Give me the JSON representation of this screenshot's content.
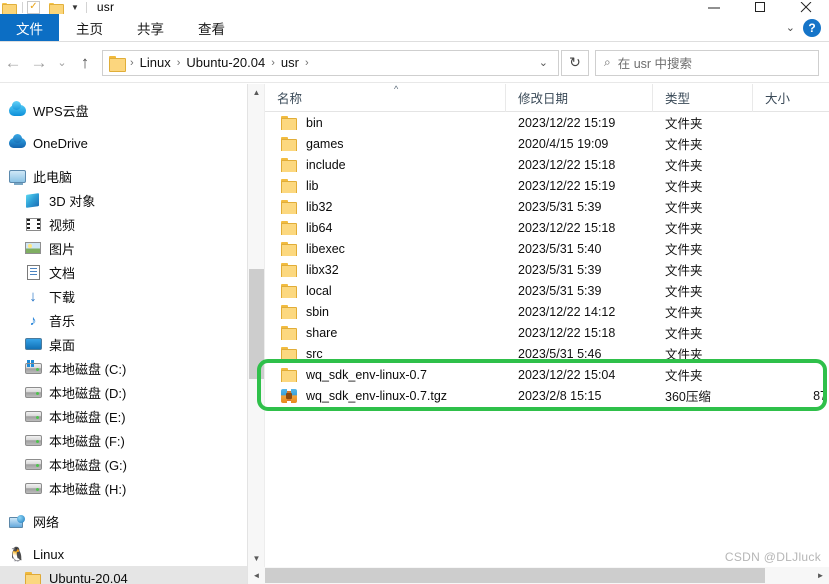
{
  "window": {
    "title": "usr",
    "quick_access": {
      "checkbox_icon": "checkbox-checked-icon",
      "folder_icon": "folder-icon",
      "dropdown_icon": "chevron-down-icon"
    },
    "controls": {
      "minimize": "minimize-icon",
      "maximize": "maximize-icon",
      "close": "close-icon"
    }
  },
  "ribbon": {
    "tabs": [
      {
        "label": "文件",
        "active": true
      },
      {
        "label": "主页",
        "active": false
      },
      {
        "label": "共享",
        "active": false
      },
      {
        "label": "查看",
        "active": false
      }
    ],
    "collapse_icon": "chevron-down-icon",
    "help_label": "?"
  },
  "navigation": {
    "back_label": "←",
    "forward_label": "→",
    "recent_label": "⌄",
    "up_label": "↑",
    "breadcrumb": [
      "Linux",
      "Ubuntu-20.04",
      "usr"
    ],
    "breadcrumb_separator": "›",
    "address_dropdown": "⌄",
    "refresh_label": "↻",
    "search": {
      "placeholder": "在 usr 中搜索",
      "icon": "search-icon"
    }
  },
  "sidebar": {
    "items": [
      {
        "label": "WPS云盘",
        "icon": "wps-cloud-icon",
        "level": 0,
        "selected": false,
        "gap_before": false
      },
      {
        "label": "OneDrive",
        "icon": "onedrive-cloud-icon",
        "level": 0,
        "selected": false,
        "gap_before": true
      },
      {
        "label": "此电脑",
        "icon": "this-pc-icon",
        "level": 0,
        "selected": false,
        "gap_before": true
      },
      {
        "label": "3D 对象",
        "icon": "3d-objects-icon",
        "level": 1,
        "selected": false,
        "gap_before": false
      },
      {
        "label": "视频",
        "icon": "videos-icon",
        "level": 1,
        "selected": false,
        "gap_before": false
      },
      {
        "label": "图片",
        "icon": "pictures-icon",
        "level": 1,
        "selected": false,
        "gap_before": false
      },
      {
        "label": "文档",
        "icon": "documents-icon",
        "level": 1,
        "selected": false,
        "gap_before": false
      },
      {
        "label": "下载",
        "icon": "downloads-icon",
        "level": 1,
        "selected": false,
        "gap_before": false
      },
      {
        "label": "音乐",
        "icon": "music-icon",
        "level": 1,
        "selected": false,
        "gap_before": false
      },
      {
        "label": "桌面",
        "icon": "desktop-icon",
        "level": 1,
        "selected": false,
        "gap_before": false
      },
      {
        "label": "本地磁盘 (C:)",
        "icon": "system-drive-icon",
        "level": 1,
        "selected": false,
        "gap_before": false
      },
      {
        "label": "本地磁盘 (D:)",
        "icon": "drive-icon",
        "level": 1,
        "selected": false,
        "gap_before": false
      },
      {
        "label": "本地磁盘 (E:)",
        "icon": "drive-icon",
        "level": 1,
        "selected": false,
        "gap_before": false
      },
      {
        "label": "本地磁盘 (F:)",
        "icon": "drive-icon",
        "level": 1,
        "selected": false,
        "gap_before": false
      },
      {
        "label": "本地磁盘 (G:)",
        "icon": "drive-icon",
        "level": 1,
        "selected": false,
        "gap_before": false
      },
      {
        "label": "本地磁盘 (H:)",
        "icon": "drive-icon",
        "level": 1,
        "selected": false,
        "gap_before": false
      },
      {
        "label": "网络",
        "icon": "network-icon",
        "level": 0,
        "selected": false,
        "gap_before": true
      },
      {
        "label": "Linux",
        "icon": "linux-penguin-icon",
        "level": 0,
        "selected": false,
        "gap_before": true
      },
      {
        "label": "Ubuntu-20.04",
        "icon": "folder-icon",
        "level": 1,
        "selected": true,
        "gap_before": false
      }
    ]
  },
  "file_list": {
    "columns": [
      {
        "key": "name",
        "label": "名称",
        "sorted": "asc"
      },
      {
        "key": "date",
        "label": "修改日期",
        "sorted": null
      },
      {
        "key": "type",
        "label": "类型",
        "sorted": null
      },
      {
        "key": "size",
        "label": "大小",
        "sorted": null
      }
    ],
    "sort_caret": "^",
    "rows": [
      {
        "name": "bin",
        "date": "2023/12/22 15:19",
        "type": "文件夹",
        "size": "",
        "icon": "folder-icon",
        "highlighted": false
      },
      {
        "name": "games",
        "date": "2020/4/15 19:09",
        "type": "文件夹",
        "size": "",
        "icon": "folder-icon",
        "highlighted": false
      },
      {
        "name": "include",
        "date": "2023/12/22 15:18",
        "type": "文件夹",
        "size": "",
        "icon": "folder-icon",
        "highlighted": false
      },
      {
        "name": "lib",
        "date": "2023/12/22 15:19",
        "type": "文件夹",
        "size": "",
        "icon": "folder-icon",
        "highlighted": false
      },
      {
        "name": "lib32",
        "date": "2023/5/31 5:39",
        "type": "文件夹",
        "size": "",
        "icon": "folder-icon",
        "highlighted": false
      },
      {
        "name": "lib64",
        "date": "2023/12/22 15:18",
        "type": "文件夹",
        "size": "",
        "icon": "folder-icon",
        "highlighted": false
      },
      {
        "name": "libexec",
        "date": "2023/5/31 5:40",
        "type": "文件夹",
        "size": "",
        "icon": "folder-icon",
        "highlighted": false
      },
      {
        "name": "libx32",
        "date": "2023/5/31 5:39",
        "type": "文件夹",
        "size": "",
        "icon": "folder-icon",
        "highlighted": false
      },
      {
        "name": "local",
        "date": "2023/5/31 5:39",
        "type": "文件夹",
        "size": "",
        "icon": "folder-icon",
        "highlighted": false
      },
      {
        "name": "sbin",
        "date": "2023/12/22 14:12",
        "type": "文件夹",
        "size": "",
        "icon": "folder-icon",
        "highlighted": false
      },
      {
        "name": "share",
        "date": "2023/12/22 15:18",
        "type": "文件夹",
        "size": "",
        "icon": "folder-icon",
        "highlighted": false
      },
      {
        "name": "src",
        "date": "2023/5/31 5:46",
        "type": "文件夹",
        "size": "",
        "icon": "folder-icon",
        "highlighted": false
      },
      {
        "name": "wq_sdk_env-linux-0.7",
        "date": "2023/12/22 15:04",
        "type": "文件夹",
        "size": "",
        "icon": "folder-icon",
        "highlighted": true
      },
      {
        "name": "wq_sdk_env-linux-0.7.tgz",
        "date": "2023/2/8 15:15",
        "type": "360压缩",
        "size": "87",
        "icon": "archive-icon",
        "highlighted": true
      }
    ]
  },
  "annotation": {
    "highlight_color": "#2fc04a"
  },
  "scrollbars": {
    "vertical_up": "▲",
    "vertical_down": "▼",
    "horizontal_left": "◄",
    "horizontal_right": "►"
  },
  "watermark": "CSDN @DLJluck"
}
